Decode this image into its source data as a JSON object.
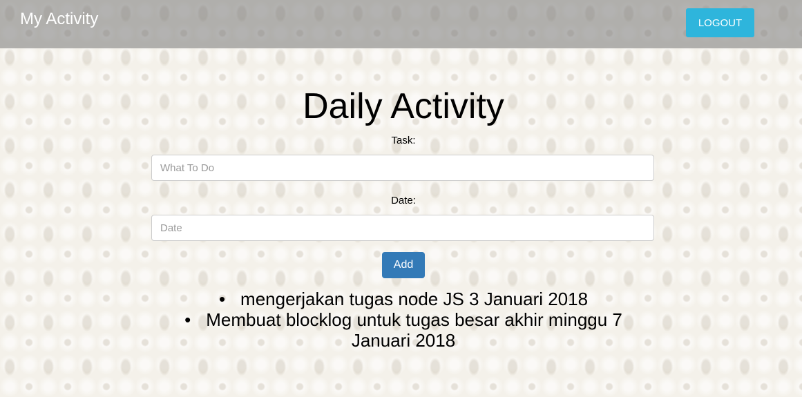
{
  "navbar": {
    "brand": "My Activity",
    "logout_label": "LOGOUT"
  },
  "main": {
    "title": "Daily Activity",
    "task_label": "Task:",
    "task_placeholder": "What To Do",
    "task_value": "",
    "date_label": "Date:",
    "date_placeholder": "Date",
    "date_value": "",
    "add_label": "Add"
  },
  "activities": [
    {
      "text": "mengerjakan tugas node JS 3 Januari 2018"
    },
    {
      "text": "Membuat blocklog untuk tugas besar akhir minggu 7 Januari 2018"
    }
  ],
  "colors": {
    "logout_button": "#2eb5dc",
    "add_button": "#337ab7",
    "navbar": "#8a8a8a"
  }
}
